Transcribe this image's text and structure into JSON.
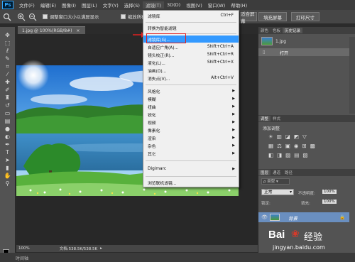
{
  "app": {
    "logo": "Ps"
  },
  "menubar": [
    "文件(F)",
    "编辑(E)",
    "图像(I)",
    "图层(L)",
    "文字(Y)",
    "选择(S)",
    "滤镜(T)",
    "3D(D)",
    "视图(V)",
    "窗口(W)",
    "帮助(H)"
  ],
  "options": {
    "resize_windows_label": "调整窗口大小以满屏显示",
    "scrubby_zoom_label": "缩放所有窗口",
    "fit_screen": "适合屏幕",
    "fill_screen": "填充屏幕",
    "print_size": "打印尺寸"
  },
  "document": {
    "tab_title": "1.jpg @ 100%(RGB/8#)",
    "zoom": "100%",
    "doc_size": "文档:538.5K/538.5K"
  },
  "filter_menu": {
    "items": [
      {
        "label": "滤镜库",
        "shortcut": "Ctrl+F"
      },
      {
        "label": "转换为智能滤镜",
        "shortcut": ""
      },
      {
        "label": "滤镜库(G)...",
        "shortcut": ""
      },
      {
        "label": "自适应广角(A)...",
        "shortcut": "Shift+Ctrl+A"
      },
      {
        "label": "镜头校正(R)...",
        "shortcut": "Shift+Ctrl+R"
      },
      {
        "label": "液化(L)...",
        "shortcut": "Shift+Ctrl+X"
      },
      {
        "label": "油画(O)...",
        "shortcut": ""
      },
      {
        "label": "消失点(V)...",
        "shortcut": "Alt+Ctrl+V"
      },
      {
        "label": "风格化",
        "shortcut": ""
      },
      {
        "label": "模糊",
        "shortcut": ""
      },
      {
        "label": "扭曲",
        "shortcut": ""
      },
      {
        "label": "锐化",
        "shortcut": ""
      },
      {
        "label": "视频",
        "shortcut": ""
      },
      {
        "label": "像素化",
        "shortcut": ""
      },
      {
        "label": "渲染",
        "shortcut": ""
      },
      {
        "label": "杂色",
        "shortcut": ""
      },
      {
        "label": "其它",
        "shortcut": ""
      },
      {
        "label": "Digimarc",
        "shortcut": ""
      },
      {
        "label": "浏览联机滤镜...",
        "shortcut": ""
      }
    ]
  },
  "history_panel": {
    "tabs": [
      "颜色",
      "色板",
      "历史记录"
    ],
    "snapshot": "1.jpg",
    "state": "打开"
  },
  "adjustments_panel": {
    "tabs": [
      "调整",
      "样式"
    ],
    "title": "添加调整"
  },
  "layers_panel": {
    "tabs": [
      "图层",
      "通道",
      "路径"
    ],
    "blend_mode": "正常",
    "opacity_label": "不透明度:",
    "opacity": "100%",
    "lock_label": "锁定:",
    "fill_label": "填充:",
    "fill": "100%",
    "layer_name": "背景"
  },
  "watermark": {
    "brand": "Bai",
    "brand_cn": "经验",
    "url": "jingyan.baidu.com"
  },
  "bottom": {
    "timeline": "时间轴"
  }
}
